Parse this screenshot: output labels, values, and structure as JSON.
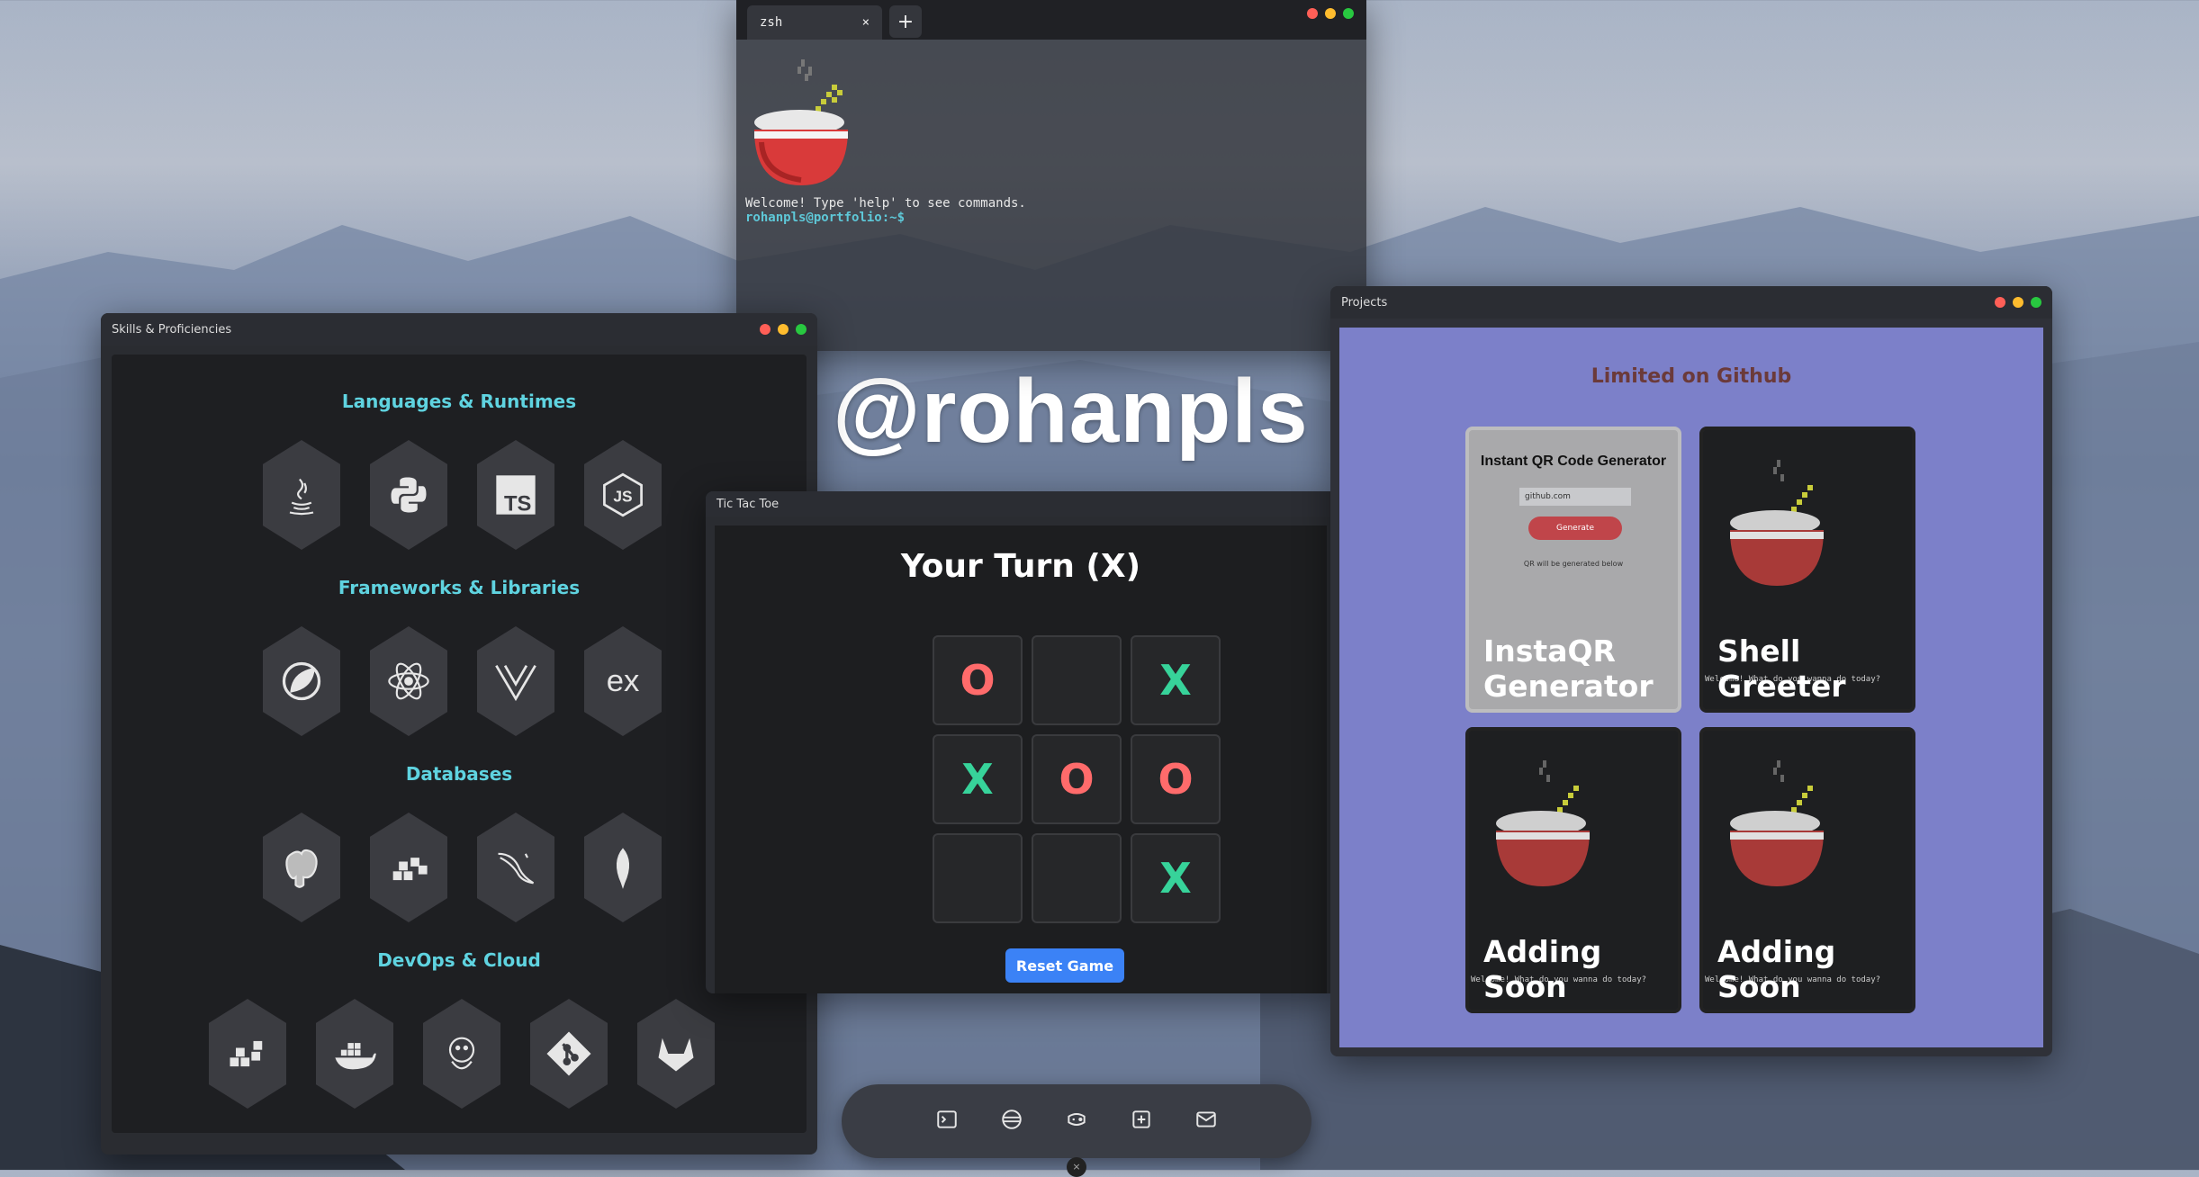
{
  "terminal": {
    "tab_label": "zsh",
    "tab_close": "×",
    "new_tab": "+",
    "welcome": "Welcome! Type 'help' to see commands.",
    "prompt": "rohanpls@portfolio:~$"
  },
  "hero": {
    "handle": "@rohanpls"
  },
  "skills": {
    "title": "Skills & Proficiencies",
    "sections": [
      {
        "title": "Languages & Runtimes",
        "icons": [
          "java-icon",
          "python-icon",
          "typescript-icon",
          "nodejs-icon"
        ]
      },
      {
        "title": "Frameworks & Libraries",
        "icons": [
          "spring-icon",
          "react-icon",
          "vue-icon",
          "express-icon"
        ]
      },
      {
        "title": "Databases",
        "icons": [
          "postgresql-icon",
          "dynamodb-icon",
          "mysql-icon",
          "mongodb-icon"
        ]
      },
      {
        "title": "DevOps & Cloud",
        "icons": [
          "aws-icon",
          "docker-icon",
          "jenkins-icon",
          "git-icon",
          "gitlab-icon"
        ]
      }
    ],
    "ts_label": "TS",
    "js_label": "JS",
    "ex_label": "ex"
  },
  "tictactoe": {
    "title": "Tic Tac Toe",
    "status": "Your Turn (X)",
    "board": [
      "O",
      "",
      "X",
      "X",
      "O",
      "O",
      "",
      "",
      "X"
    ],
    "reset_label": "Reset Game"
  },
  "projects": {
    "title": "Projects",
    "limited": "Limited on Github",
    "qr": {
      "heading": "Instant QR Code Generator",
      "input": "github.com",
      "button": "Generate",
      "note": "QR will be generated below"
    },
    "cards": [
      {
        "title_1": "InstaQR",
        "title_2": "Generator"
      },
      {
        "title_1": "Shell",
        "title_2": "Greeter",
        "term": "Welcome! What do you wanna do today?"
      },
      {
        "title_1": "Adding",
        "title_2": "Soon",
        "term": "Welcome! What do you wanna do today?"
      },
      {
        "title_1": "Adding",
        "title_2": "Soon",
        "term": "Welcome! What do you wanna do today?"
      }
    ]
  },
  "dock": {
    "items": [
      "terminal-icon",
      "database-icon",
      "gamepad-icon",
      "plus-square-icon",
      "mail-icon"
    ]
  },
  "colors": {
    "accent_cyan": "#5fd3e0",
    "x_color": "#37d39a",
    "o_color": "#ff6b6b",
    "reset_blue": "#3b82f6",
    "projects_bg": "#7c80c9"
  }
}
